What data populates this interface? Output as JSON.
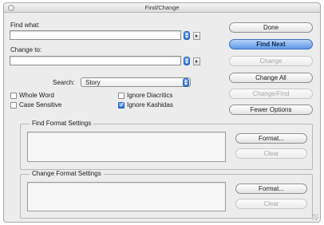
{
  "window": {
    "title": "Find/Change"
  },
  "find": {
    "label": "Find what:",
    "value": ""
  },
  "change": {
    "label": "Change to:",
    "value": ""
  },
  "search": {
    "label": "Search:",
    "value": "Story"
  },
  "options": [
    {
      "label": "Whole Word",
      "checked": false
    },
    {
      "label": "Case Sensitive",
      "checked": false
    },
    {
      "label": "Ignore Diacritics",
      "checked": false
    },
    {
      "label": "Ignore Kashidas",
      "checked": true
    }
  ],
  "buttons": {
    "done": "Done",
    "find_next": "Find Next",
    "change": "Change",
    "change_all": "Change All",
    "change_find": "Change/Find",
    "fewer_options": "Fewer Options"
  },
  "find_format": {
    "label": "Find Format Settings",
    "format": "Format...",
    "clear": "Clear"
  },
  "change_format": {
    "label": "Change Format Settings",
    "format": "Format...",
    "clear": "Clear"
  }
}
